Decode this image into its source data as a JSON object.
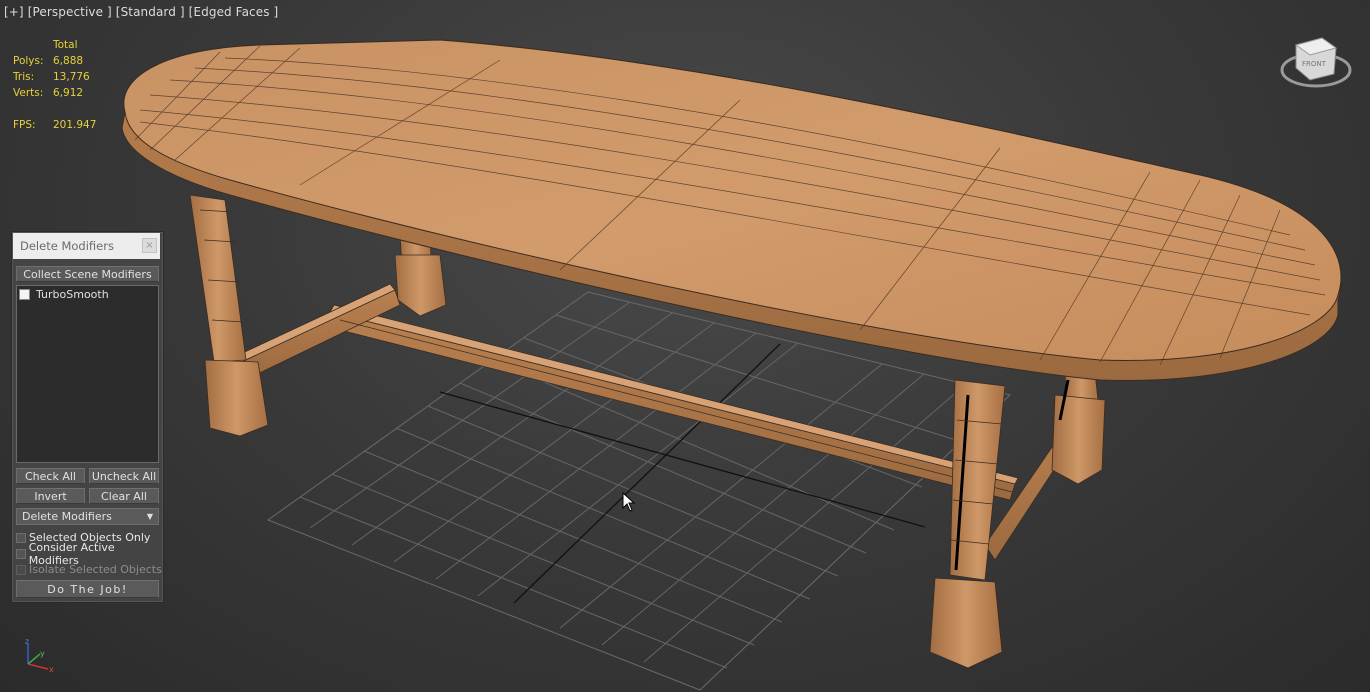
{
  "viewport": {
    "labels": [
      "[+]",
      "[Perspective ]",
      "[Standard ]",
      "[Edged Faces ]"
    ]
  },
  "stats": {
    "header": "Total",
    "rows": [
      {
        "key": "Polys:",
        "value": "6,888"
      },
      {
        "key": "Tris:",
        "value": "13,776"
      },
      {
        "key": "Verts:",
        "value": "6,912"
      }
    ],
    "fps_key": "FPS:",
    "fps_value": "201.947",
    "color": "#e6d13a"
  },
  "panel": {
    "title": "Delete Modifiers",
    "close_label": "×",
    "collect_button": "Collect Scene Modifiers",
    "list_items": [
      {
        "label": "TurboSmooth",
        "checked": false
      }
    ],
    "check_all": "Check All",
    "uncheck_all": "Uncheck All",
    "invert": "Invert",
    "clear_all": "Clear All",
    "mode_select": "Delete Modifiers",
    "options": [
      {
        "label": "Selected Objects Only",
        "checked": false,
        "enabled": true
      },
      {
        "label": "Consider Active Modifiers",
        "checked": false,
        "enabled": true
      },
      {
        "label": "Isolate Selected Objects",
        "checked": false,
        "enabled": false
      }
    ],
    "do_button": "Do The Job!"
  },
  "viewcube": {
    "face_label": "FRONT"
  },
  "axis": {
    "x": "x",
    "y": "y",
    "z": "z"
  },
  "colors": {
    "wood": "#c88f5e",
    "wood_dark": "#a8703f",
    "wire": "#3a2c22",
    "grid": "#6a6a6a",
    "grid_axis": "#111111"
  }
}
